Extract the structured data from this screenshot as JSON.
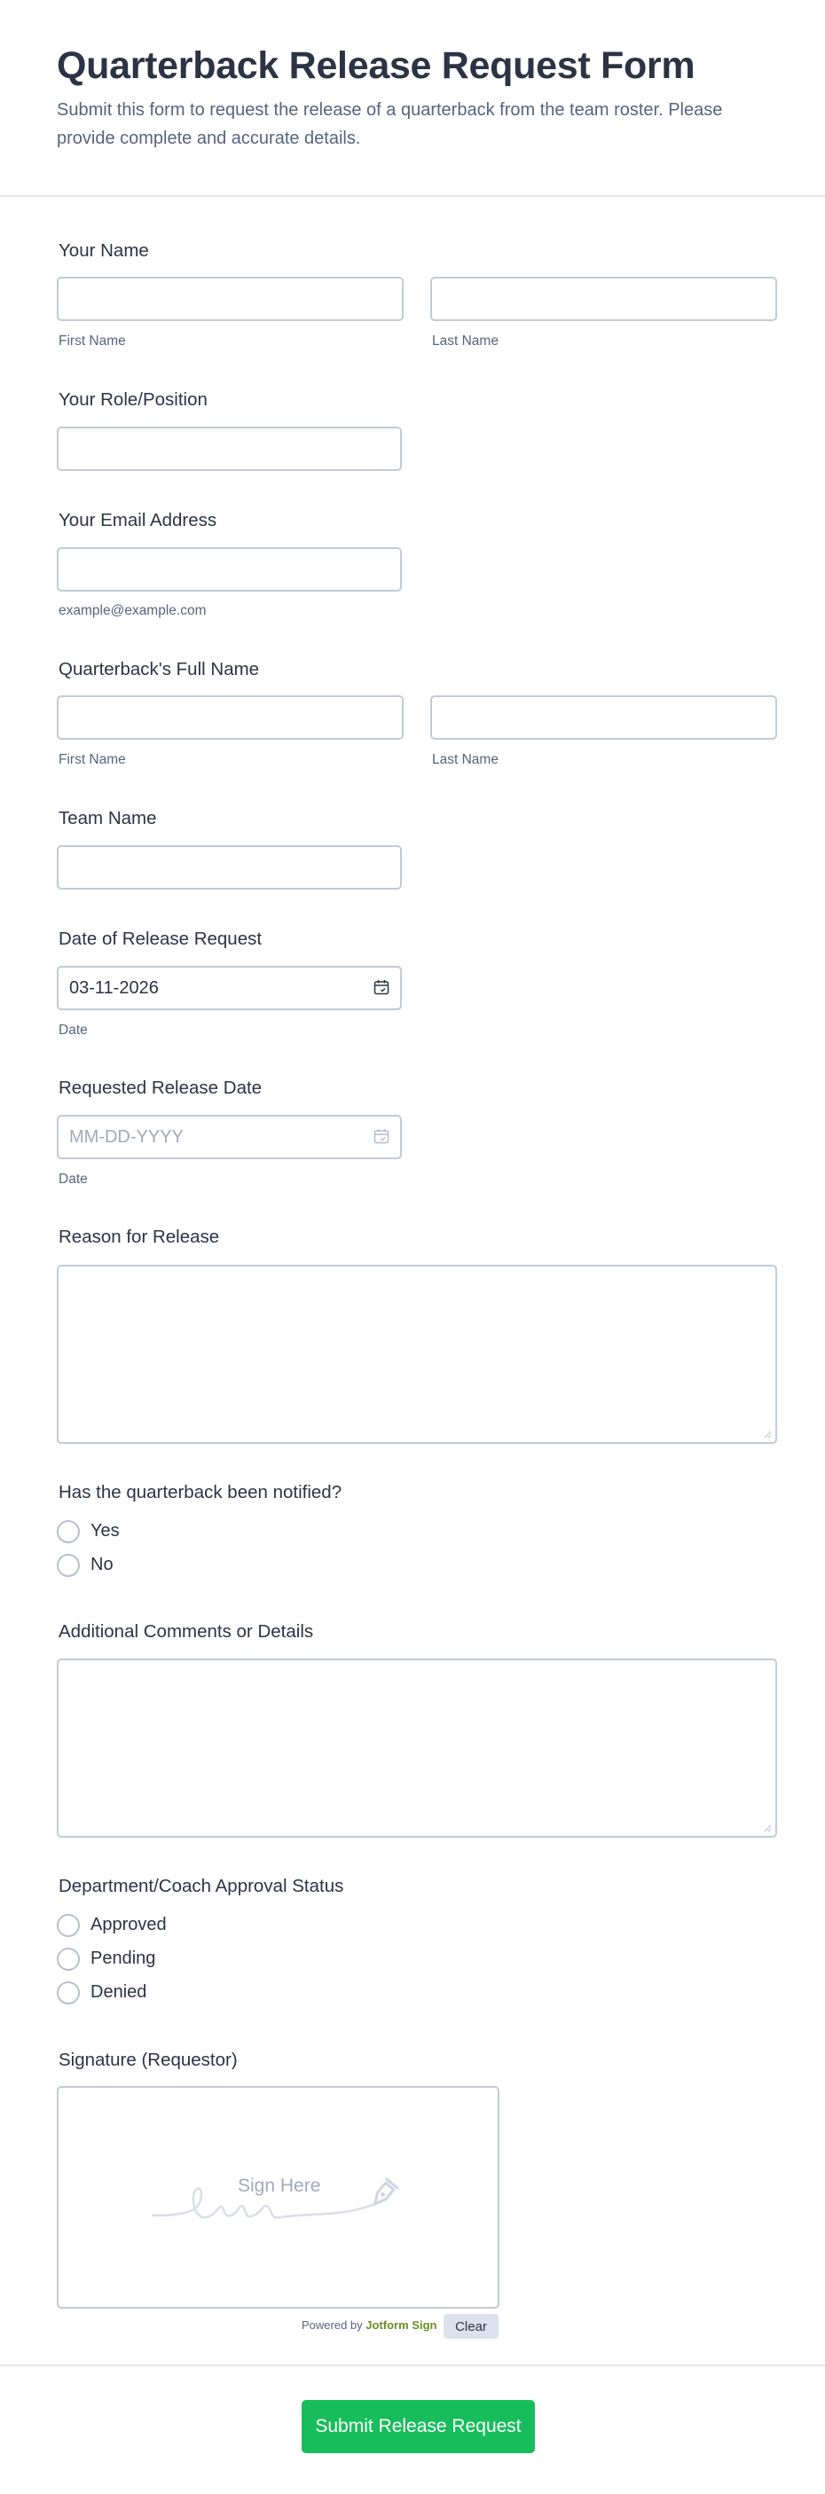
{
  "form": {
    "title": "Quarterback Release Request Form",
    "description": "Submit this form to request the release of a quarterback from the team roster. Please provide complete and accurate details."
  },
  "fields": {
    "your_name": {
      "label": "Your Name",
      "first_sub": "First Name",
      "last_sub": "Last Name",
      "first_value": "",
      "last_value": ""
    },
    "role": {
      "label": "Your Role/Position",
      "value": ""
    },
    "email": {
      "label": "Your Email Address",
      "value": "",
      "sub": "example@example.com"
    },
    "qb_name": {
      "label": "Quarterback's Full Name",
      "first_sub": "First Name",
      "last_sub": "Last Name",
      "first_value": "",
      "last_value": ""
    },
    "team": {
      "label": "Team Name",
      "value": ""
    },
    "request_date": {
      "label": "Date of Release Request",
      "value": "03-11-2026",
      "sub": "Date"
    },
    "release_date": {
      "label": "Requested Release Date",
      "placeholder": "MM-DD-YYYY",
      "value": "",
      "sub": "Date"
    },
    "reason": {
      "label": "Reason for Release",
      "value": ""
    },
    "notified": {
      "label": "Has the quarterback been notified?",
      "options": [
        "Yes",
        "No"
      ]
    },
    "comments": {
      "label": "Additional Comments or Details",
      "value": ""
    },
    "approval": {
      "label": "Department/Coach Approval Status",
      "options": [
        "Approved",
        "Pending",
        "Denied"
      ]
    },
    "signature": {
      "label": "Signature (Requestor)",
      "placeholder": "Sign Here",
      "powered_prefix": "Powered by",
      "powered_brand": "Jotform Sign",
      "clear_label": "Clear"
    }
  },
  "submit_label": "Submit Release Request",
  "colors": {
    "submit": "#18bd5b",
    "border": "#c3cad8",
    "text": "#2c3345",
    "sublabel": "#57647e"
  },
  "icons": {
    "date": "calendar-icon",
    "signature": "pen-nib-icon"
  }
}
